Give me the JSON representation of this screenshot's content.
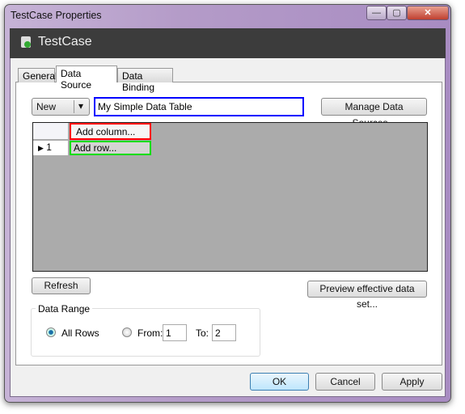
{
  "window": {
    "title": "TestCase Properties",
    "minimize": "—",
    "maximize": "▢",
    "close": "✕"
  },
  "header": {
    "title": "TestCase",
    "icon": "testcase-icon"
  },
  "tabs": [
    {
      "label": "General",
      "active": false
    },
    {
      "label": "Data Source",
      "active": true
    },
    {
      "label": "Data Binding",
      "active": false
    }
  ],
  "source": {
    "new_label": "New",
    "dropdown": "▾",
    "name_value": "My Simple Data Table",
    "manage_label": "Manage Data Sources..."
  },
  "grid": {
    "add_column": "Add column...",
    "rows": [
      {
        "indicator": "▶",
        "number": "1",
        "cell": "Add row..."
      }
    ]
  },
  "refresh_label": "Refresh",
  "preview_label": "Preview effective data set...",
  "range": {
    "legend": "Data Range",
    "all_rows": "All Rows",
    "from_label": "From:",
    "from_value": "1",
    "to_label": "To:",
    "to_value": "2",
    "selected": "All Rows"
  },
  "footer": {
    "ok": "OK",
    "cancel": "Cancel",
    "apply": "Apply"
  },
  "colors": {
    "name_border": "#0000ff",
    "add_column_border": "#ff0000",
    "add_row_border": "#00dd00"
  }
}
